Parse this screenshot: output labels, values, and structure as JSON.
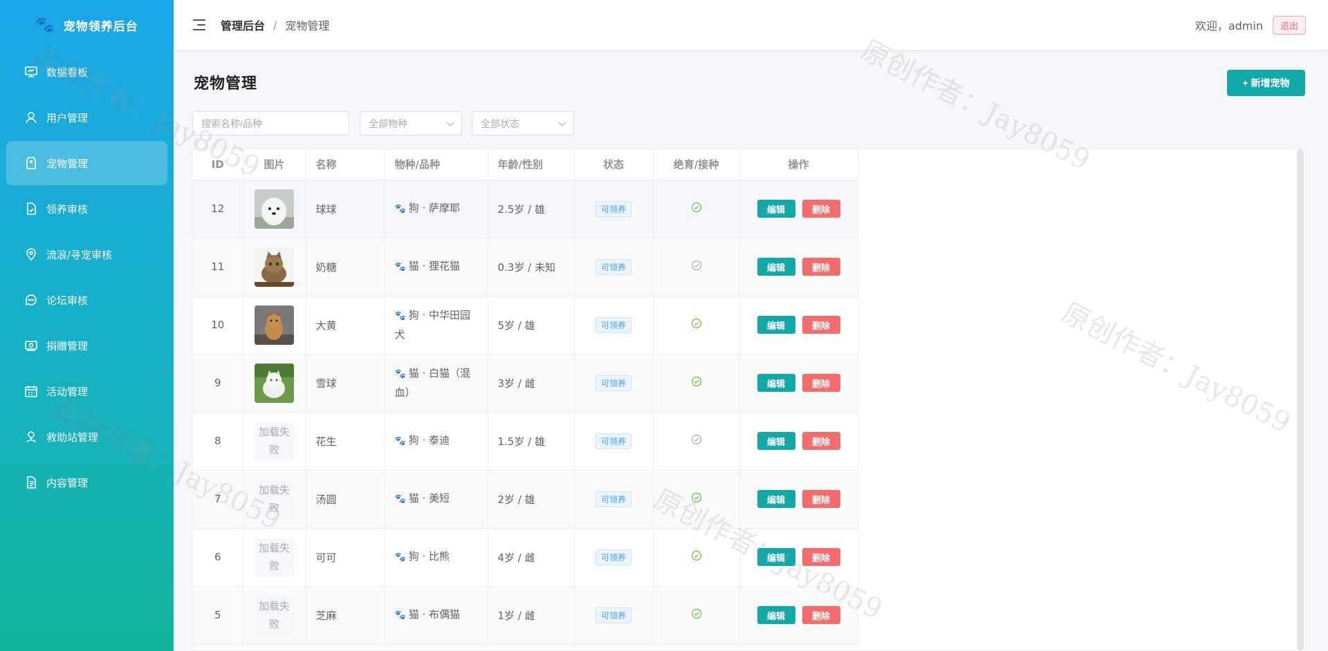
{
  "brand": {
    "name": "宠物领养后台",
    "icon": "paw-icon"
  },
  "sidebar": {
    "items": [
      {
        "label": "数据看板",
        "icon": "dashboard-icon",
        "active": false
      },
      {
        "label": "用户管理",
        "icon": "user-icon",
        "active": false
      },
      {
        "label": "宠物管理",
        "icon": "tag-icon",
        "active": true
      },
      {
        "label": "领养审核",
        "icon": "document-check-icon",
        "active": false
      },
      {
        "label": "流浪/寻宠审核",
        "icon": "location-icon",
        "active": false
      },
      {
        "label": "论坛审核",
        "icon": "chat-icon",
        "active": false
      },
      {
        "label": "捐赠管理",
        "icon": "money-icon",
        "active": false
      },
      {
        "label": "活动管理",
        "icon": "calendar-icon",
        "active": false
      },
      {
        "label": "救助站管理",
        "icon": "place-icon",
        "active": false
      },
      {
        "label": "内容管理",
        "icon": "file-icon",
        "active": false
      }
    ]
  },
  "header": {
    "breadcrumb_root": "管理后台",
    "breadcrumb_sep": "/",
    "breadcrumb_current": "宠物管理",
    "welcome": "欢迎，admin",
    "logout": "退出"
  },
  "main": {
    "title": "宠物管理",
    "add_button": "+ 新增宠物",
    "search_placeholder": "搜索名称/品种",
    "filter_species": "全部物种",
    "filter_status": "全部状态"
  },
  "table": {
    "columns": [
      "ID",
      "图片",
      "名称",
      "物种/品种",
      "年龄/性别",
      "状态",
      "绝育/接种",
      "操作"
    ],
    "edit_label": "编辑",
    "delete_label": "删除",
    "fail_label": "加载失败",
    "rows": [
      {
        "id": "12",
        "image": "samoyed",
        "name": "球球",
        "species": "狗 · 萨摩耶",
        "age_sex": "2.5岁 / 雄",
        "status": "可领养",
        "neutered": true
      },
      {
        "id": "11",
        "image": "tabby-cat",
        "name": "奶糖",
        "species": "猫 · 狸花猫",
        "age_sex": "0.3岁 / 未知",
        "status": "可领养",
        "neutered": false
      },
      {
        "id": "10",
        "image": "yellow-dog",
        "name": "大黄",
        "species": "狗 · 中华田园犬",
        "age_sex": "5岁 / 雄",
        "status": "可领养",
        "neutered": true
      },
      {
        "id": "9",
        "image": "white-cat",
        "name": "雪球",
        "species": "猫 · 白猫（混血）",
        "age_sex": "3岁 / 雌",
        "status": "可领养",
        "neutered": true
      },
      {
        "id": "8",
        "image": "failed",
        "name": "花生",
        "species": "狗 · 泰迪",
        "age_sex": "1.5岁 / 雄",
        "status": "可领养",
        "neutered": false
      },
      {
        "id": "7",
        "image": "failed",
        "name": "汤圆",
        "species": "猫 · 美短",
        "age_sex": "2岁 / 雄",
        "status": "可领养",
        "neutered": true
      },
      {
        "id": "6",
        "image": "failed",
        "name": "可可",
        "species": "狗 · 比熊",
        "age_sex": "4岁 / 雌",
        "status": "可领养",
        "neutered": true
      },
      {
        "id": "5",
        "image": "failed",
        "name": "芝麻",
        "species": "猫 · 布偶猫",
        "age_sex": "1岁 / 雌",
        "status": "可领养",
        "neutered": true
      }
    ]
  },
  "watermark": "原创作者：Jay8059",
  "colors": {
    "accent": "#13a8a8",
    "danger": "#f56c6c",
    "success": "#67c23a",
    "sidebar_top": "#1aa6e8",
    "sidebar_bottom": "#13b49a"
  }
}
